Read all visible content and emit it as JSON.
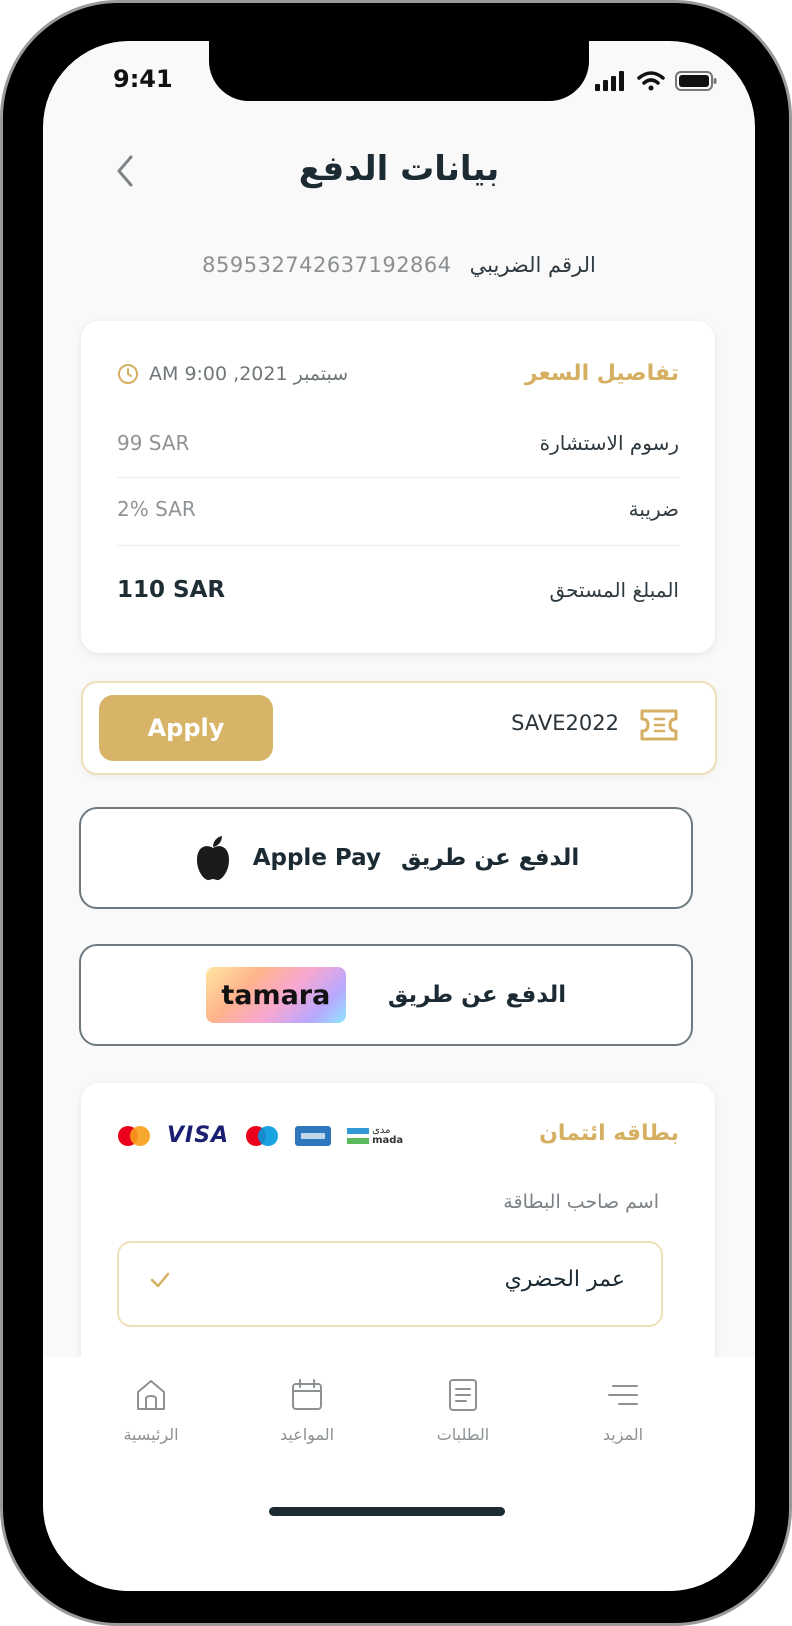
{
  "status_bar": {
    "time": "9:41"
  },
  "header": {
    "title": "بيانات الدفع"
  },
  "tax": {
    "label": "الرقم الضريبي",
    "number": "859532742637192864"
  },
  "price_details": {
    "title": "تفاصيل السعر",
    "datetime": "سبتمبر 2021, 9:00 AM",
    "rows": [
      {
        "label": "رسوم الاستشارة",
        "value": "99 SAR"
      },
      {
        "label": "ضريبة",
        "value": "2% SAR"
      },
      {
        "label": "المبلغ المستحق",
        "value": "110 SAR"
      }
    ]
  },
  "coupon": {
    "code": "SAVE2022",
    "apply_label": "Apply"
  },
  "apple_pay": {
    "label": "الدفع عن طريق",
    "brand": "Apple Pay"
  },
  "tamara_pay": {
    "label": "الدفع عن طريق",
    "brand": "tamara"
  },
  "credit_card": {
    "title": "بطاقه ائتمان",
    "brands": [
      "mastercard",
      "VISA",
      "maestro",
      "amex",
      "mada"
    ],
    "visa_text": "VISA",
    "mada_text": "mada",
    "mada_ar": "مدى",
    "holder_label": "اسم صاحب البطاقة",
    "holder_value": "عمر الحضري"
  },
  "tabs": [
    {
      "label": "الرئيسية",
      "icon": "home-icon"
    },
    {
      "label": "المواعيد",
      "icon": "calendar-icon"
    },
    {
      "label": "الطلبات",
      "icon": "orders-icon"
    },
    {
      "label": "المزيد",
      "icon": "more-icon"
    }
  ],
  "colors": {
    "accent": "#d8b469",
    "text": "#1b2a33",
    "muted": "#8f9396"
  }
}
